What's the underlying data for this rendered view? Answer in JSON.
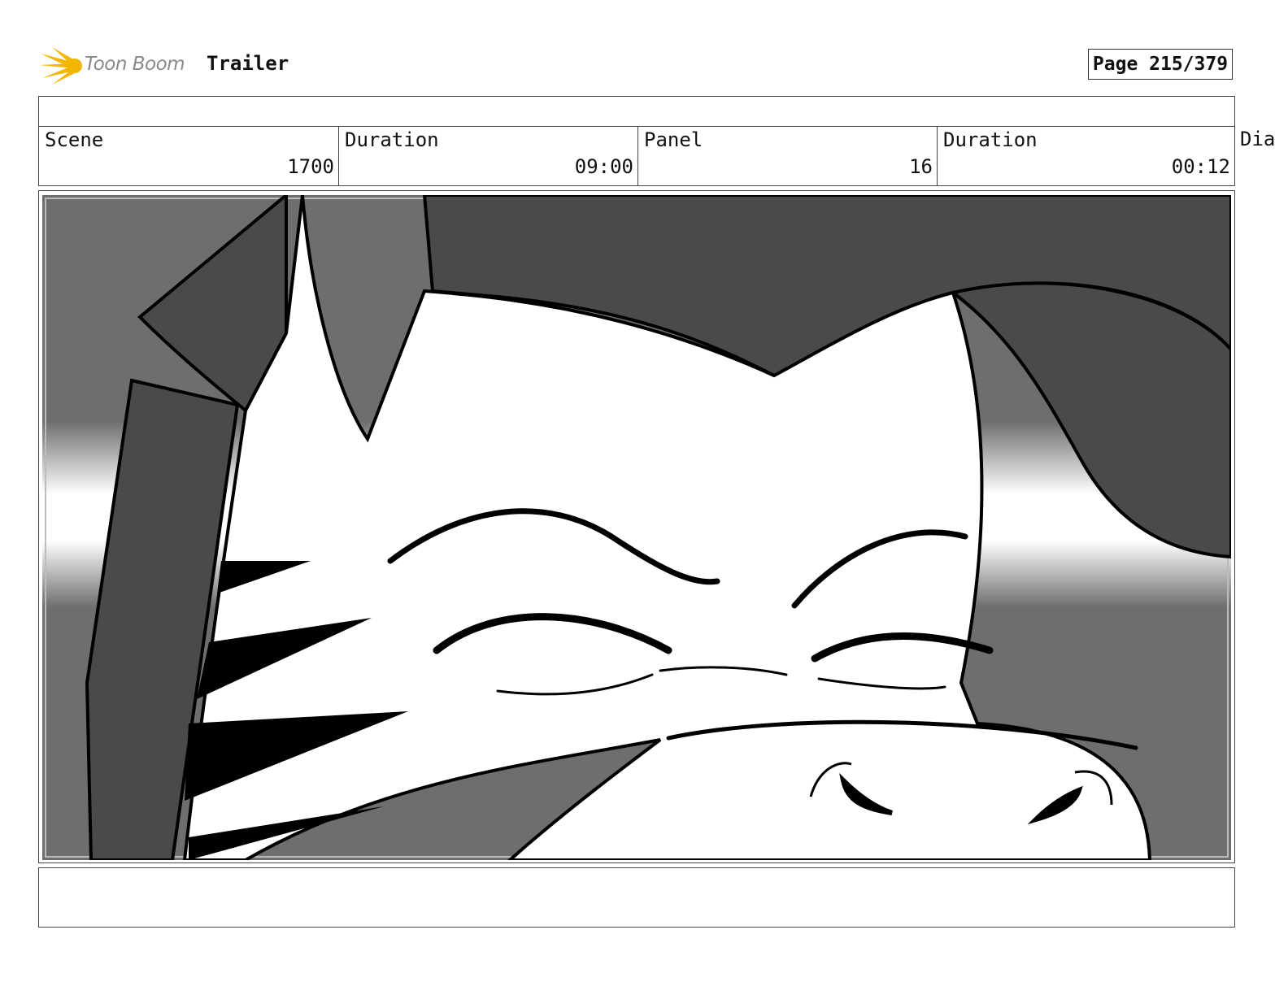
{
  "header": {
    "logo_text": "Toon Boom",
    "project_title": "Trailer",
    "page_label": "Page 215/379"
  },
  "info": {
    "scene_label": "Scene",
    "scene_value": "1700",
    "scene_duration_label": "Duration",
    "scene_duration_value": "09:00",
    "panel_label": "Panel",
    "panel_value": "16",
    "panel_duration_label": "Duration",
    "panel_duration_value": "00:12",
    "dialogue_label_partial": "Dia"
  },
  "panel": {
    "description": "",
    "caption": ""
  },
  "colors": {
    "logo_accent": "#f2b705",
    "sketch_dark": "#4a4a4a",
    "sketch_mid": "#6e6e6e",
    "ink": "#000000"
  }
}
